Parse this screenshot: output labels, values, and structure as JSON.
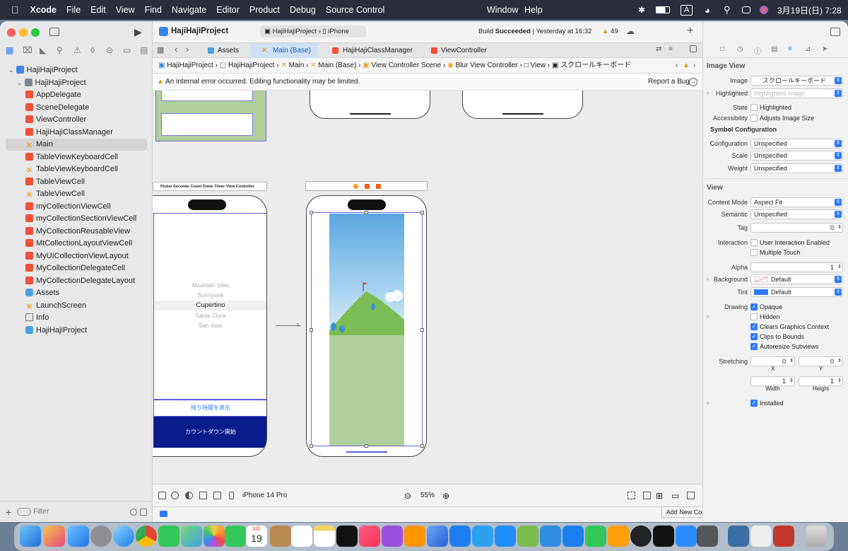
{
  "menubar": {
    "app": "Xcode",
    "items": [
      "File",
      "Edit",
      "View",
      "Find",
      "Navigate",
      "Editor",
      "Product",
      "Debug",
      "Source Control"
    ],
    "window": "Window",
    "help": "Help",
    "input": "A",
    "clock": "3月19日(日)  7:28"
  },
  "toolbar": {
    "scheme": "HajiHajiProject",
    "scheme_target": "HajiHajiProject",
    "device": "iPhone",
    "status_prefix": "Build",
    "status_strong": "Succeeded",
    "status_time": "| Yesterday at 16:32",
    "warnings": "49"
  },
  "tabs": [
    {
      "label": "Assets"
    },
    {
      "label": "Main (Base)"
    },
    {
      "label": "HajiHajiClassManager"
    },
    {
      "label": "ViewController"
    }
  ],
  "jumpbar": [
    "HajiHajiProject",
    "HajiHajiProject",
    "Main",
    "Main (Base)",
    "View Controller Scene",
    "Blur View Controller",
    "View",
    "スクロールキーボード"
  ],
  "warning": {
    "text": "An internal error occurred. Editing functionality may be limited.",
    "report": "Report a Bug"
  },
  "navigator": {
    "items": [
      {
        "label": "HajiHajiProject",
        "icon": "project-icon",
        "indent": 0
      },
      {
        "label": "HajiHajiProject",
        "icon": "folder-icon",
        "indent": 1
      },
      {
        "label": "AppDelegate",
        "icon": "swift-file-icon",
        "indent": 2
      },
      {
        "label": "SceneDelegate",
        "icon": "swift-file-icon",
        "indent": 2
      },
      {
        "label": "ViewController",
        "icon": "swift-file-icon",
        "indent": 2
      },
      {
        "label": "HajiHajiClassManager",
        "icon": "swift-file-icon",
        "indent": 2
      },
      {
        "label": "Main",
        "icon": "storyboard-icon",
        "indent": 2,
        "selected": true
      },
      {
        "label": "TableViewKeyboardCell",
        "icon": "swift-file-icon",
        "indent": 2
      },
      {
        "label": "TableViewKeyboardCell",
        "icon": "storyboard-icon",
        "indent": 2
      },
      {
        "label": "TableViewCell",
        "icon": "swift-file-icon",
        "indent": 2
      },
      {
        "label": "TableViewCell",
        "icon": "storyboard-icon",
        "indent": 2
      },
      {
        "label": "myCollectionViewCell",
        "icon": "swift-file-icon",
        "indent": 2
      },
      {
        "label": "myCollectionSectionViewCell",
        "icon": "swift-file-icon",
        "indent": 2
      },
      {
        "label": "MyCollectionReusableView",
        "icon": "swift-file-icon",
        "indent": 2
      },
      {
        "label": "MtCollectionLayoutViewCell",
        "icon": "swift-file-icon",
        "indent": 2
      },
      {
        "label": "MyUICollectionViewLayout",
        "icon": "swift-file-icon",
        "indent": 2
      },
      {
        "label": "MyCollectionDelegateCell",
        "icon": "swift-file-icon",
        "indent": 2
      },
      {
        "label": "MyCollectionDelegateLayout",
        "icon": "swift-file-icon",
        "indent": 2
      },
      {
        "label": "Assets",
        "icon": "asset-catalog-icon",
        "indent": 2
      },
      {
        "label": "LaunchScreen",
        "icon": "storyboard-icon",
        "indent": 2
      },
      {
        "label": "Info",
        "icon": "plist-icon",
        "indent": 2
      },
      {
        "label": "HajiHajiProject",
        "icon": "test-icon",
        "indent": 2
      }
    ],
    "filter_placeholder": "Filter"
  },
  "canvas": {
    "scene_title": "Picker Seconds Count Down Timer View Controller",
    "picker": [
      "Mountain View",
      "Sunnyvale",
      "Cupertino",
      "Santa Clara",
      "San Jose"
    ],
    "picker_selected": 2,
    "show_remaining": "残り時間を表示",
    "start_countdown": "カウントダウン開始"
  },
  "bottombar": {
    "device": "iPhone 14 Pro",
    "zoom": "55%"
  },
  "tooltip": "Add New Constraints",
  "inspector": {
    "section1": "Image View",
    "image_label": "Image",
    "image_value": "スクロールキーボード",
    "highlighted_label": "Highlighted",
    "highlighted_placeholder": "Highlighted Image",
    "state_label": "State",
    "state_value": "Highlighted",
    "accessibility_label": "Accessibility",
    "accessibility_value": "Adjusts Image Size",
    "symbol_header": "Symbol Configuration",
    "configuration_label": "Configuration",
    "configuration_value": "Unspecified",
    "scale_label": "Scale",
    "scale_value": "Unspecified",
    "weight_label": "Weight",
    "weight_value": "Unspecified",
    "section2": "View",
    "content_mode_label": "Content Mode",
    "content_mode_value": "Aspect Fit",
    "semantic_label": "Semantic",
    "semantic_value": "Unspecified",
    "tag_label": "Tag",
    "tag_value": "0",
    "interaction_label": "Interaction",
    "user_interaction": "User Interaction Enabled",
    "multiple_touch": "Multiple Touch",
    "alpha_label": "Alpha",
    "alpha_value": "1",
    "background_label": "Background",
    "background_value": "Default",
    "tint_label": "Tint",
    "tint_value": "Default",
    "drawing_label": "Drawing",
    "opaque": "Opaque",
    "hidden": "Hidden",
    "clears": "Clears Graphics Context",
    "clips": "Clips to Bounds",
    "autoresize": "Autoresize Subviews",
    "stretching_label": "Stretching",
    "stretch_x": "0",
    "stretch_y": "0",
    "stretch_w": "1",
    "stretch_h": "1",
    "x_label": "X",
    "y_label": "Y",
    "width_label": "Width",
    "height_label": "Height",
    "installed": "Installed"
  },
  "dock": {
    "calendar_month": "3月",
    "calendar_day": "19"
  },
  "colors": {
    "accent": "#2f7bf5",
    "selection": "#d4d4d4",
    "storyboard_accent": "#f0a030",
    "swift": "#f05138",
    "countdown_button": "#0a1b8c"
  }
}
